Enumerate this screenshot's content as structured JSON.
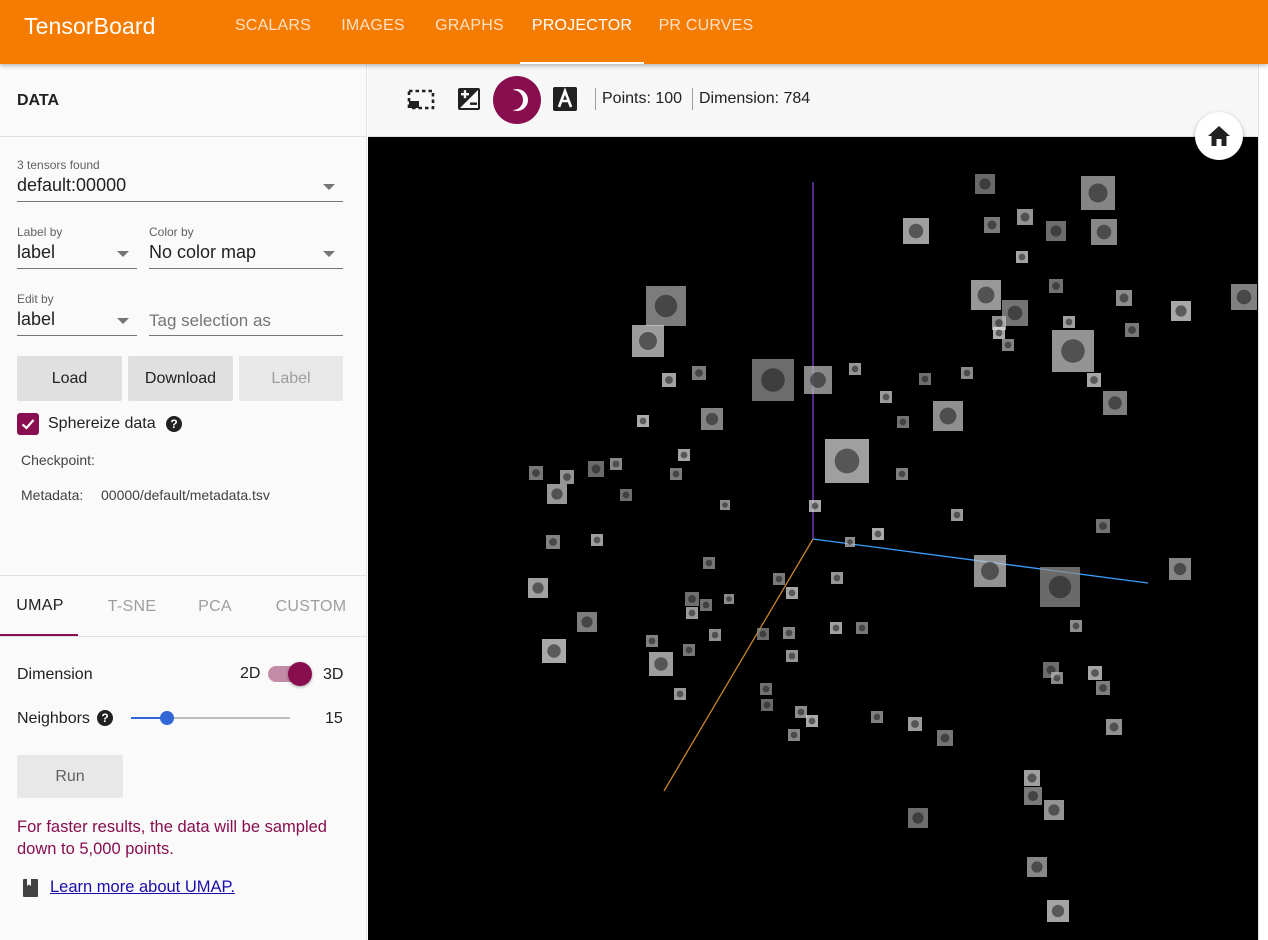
{
  "app": {
    "title": "TensorBoard"
  },
  "nav": {
    "tabs": [
      "SCALARS",
      "IMAGES",
      "GRAPHS",
      "PROJECTOR",
      "PR CURVES"
    ],
    "active": "PROJECTOR"
  },
  "data_panel": {
    "title": "DATA",
    "tensors_found": "3 tensors found",
    "tensor_select": "default:00000",
    "label_by_label": "Label by",
    "label_by_value": "label",
    "color_by_label": "Color by",
    "color_by_value": "No color map",
    "edit_by_label": "Edit by",
    "edit_by_value": "label",
    "tag_placeholder": "Tag selection as",
    "load": "Load",
    "download": "Download",
    "label_button": "Label",
    "sphereize": "Sphereize data",
    "sphereize_checked": true,
    "checkpoint_label": "Checkpoint:",
    "checkpoint_value": "",
    "metadata_label": "Metadata:",
    "metadata_value": "00000/default/metadata.tsv"
  },
  "projection": {
    "tabs": [
      "UMAP",
      "T-SNE",
      "PCA",
      "CUSTOM"
    ],
    "active": "UMAP",
    "dimension_label": "Dimension",
    "dim_2d": "2D",
    "dim_3d": "3D",
    "dimension_selected": "3D",
    "neighbors_label": "Neighbors",
    "neighbors_value": "15",
    "run": "Run",
    "note": "For faster results, the data will be sampled down to 5,000 points.",
    "learn_more": "Learn more about UMAP."
  },
  "toolbar": {
    "icons": [
      "select-rectangle-icon",
      "edit-image-icon",
      "night-mode-icon",
      "label-toggle-icon"
    ],
    "night_mode_active": true,
    "points": "Points: 100",
    "dimension": "Dimension: 784"
  },
  "canvas": {
    "background": "#000000",
    "axis_colors": {
      "vertical": "#7b3fd1",
      "horizontal": "#3aa0ff",
      "depth": "#c8862a"
    },
    "home_icon": "home-icon"
  },
  "colors": {
    "accent_orange": "#f57c00",
    "accent_magenta": "#880e4f",
    "slider_blue": "#3367d6"
  }
}
